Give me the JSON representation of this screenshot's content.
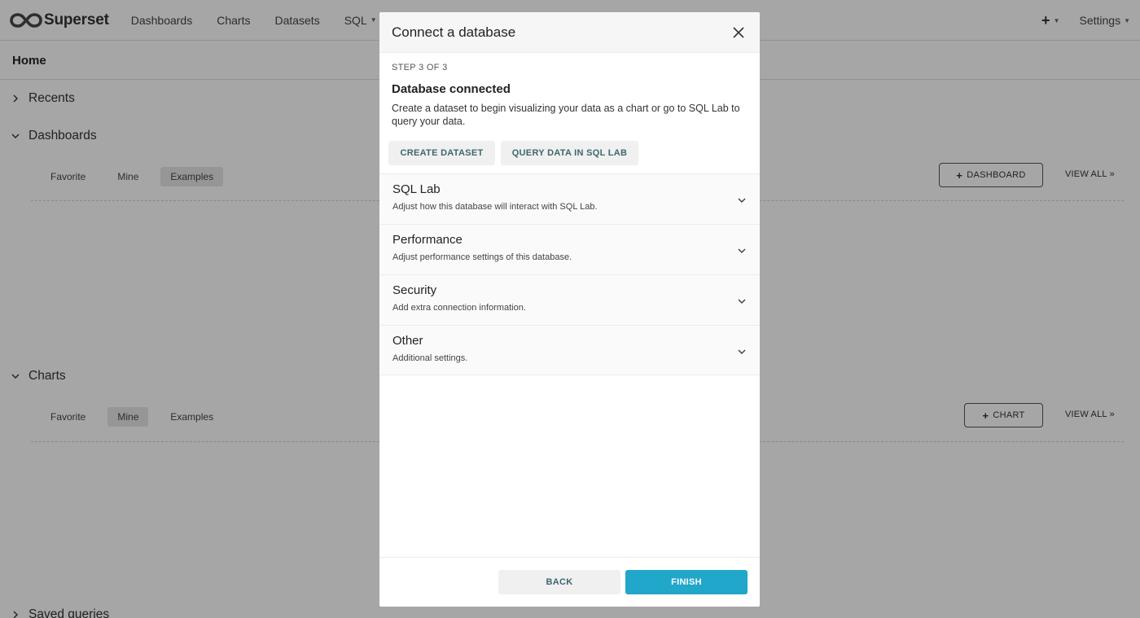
{
  "navbar": {
    "brand": "Superset",
    "items": [
      {
        "label": "Dashboards",
        "has_caret": false
      },
      {
        "label": "Charts",
        "has_caret": false
      },
      {
        "label": "Datasets",
        "has_caret": false
      },
      {
        "label": "SQL",
        "has_caret": true
      }
    ],
    "plus_icon": "plus-icon",
    "settings_label": "Settings"
  },
  "page": {
    "title": "Home"
  },
  "sections": {
    "recents": {
      "label": "Recents"
    },
    "dashboards": {
      "label": "Dashboards",
      "tabs": [
        "Favorite",
        "Mine",
        "Examples"
      ],
      "active_tab": "Examples",
      "add_button": "DASHBOARD",
      "view_all": "VIEW ALL »"
    },
    "charts": {
      "label": "Charts",
      "tabs": [
        "Favorite",
        "Mine",
        "Examples"
      ],
      "active_tab": "Mine",
      "add_button": "CHART",
      "view_all": "VIEW ALL »"
    },
    "saved_queries": {
      "label": "Saved queries"
    }
  },
  "modal": {
    "title": "Connect a database",
    "step": "STEP 3 OF 3",
    "heading": "Database connected",
    "description": "Create a dataset to begin visualizing your data as a chart or go to SQL Lab to query your data.",
    "create_dataset": "CREATE DATASET",
    "query_data": "QUERY DATA IN SQL LAB",
    "panels": [
      {
        "title": "SQL Lab",
        "desc": "Adjust how this database will interact with SQL Lab."
      },
      {
        "title": "Performance",
        "desc": "Adjust performance settings of this database."
      },
      {
        "title": "Security",
        "desc": "Add extra connection information."
      },
      {
        "title": "Other",
        "desc": "Additional settings."
      }
    ],
    "back": "BACK",
    "finish": "FINISH"
  },
  "colors": {
    "primary": "#20a7c9",
    "secondary_text": "#3d6670",
    "overlay": "rgba(0,0,0,0.35)"
  }
}
